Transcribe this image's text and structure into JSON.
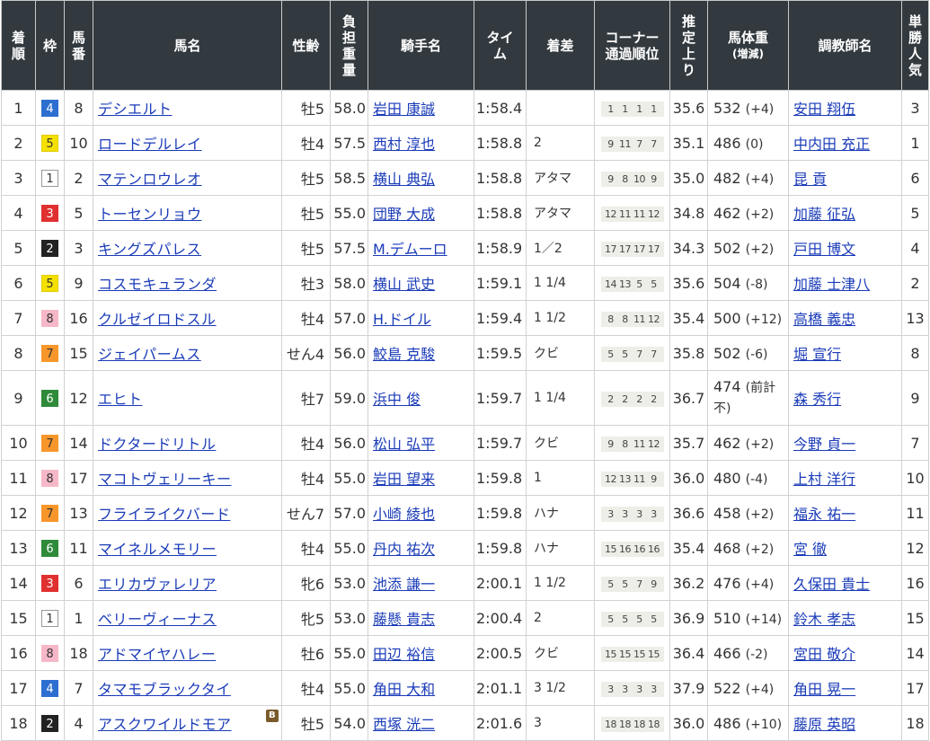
{
  "colors": {
    "header_bg": "#333a3f",
    "link": "#1a3bb8",
    "waku": {
      "1": {
        "bg": "#ffffff",
        "fg": "#333333",
        "border": "#999999"
      },
      "2": {
        "bg": "#222222",
        "fg": "#ffffff",
        "border": "#222222"
      },
      "3": {
        "bg": "#e03030",
        "fg": "#ffffff",
        "border": "#e03030"
      },
      "4": {
        "bg": "#2d6fd0",
        "fg": "#ffffff",
        "border": "#2d6fd0"
      },
      "5": {
        "bg": "#f5e000",
        "fg": "#333333",
        "border": "#e0cc00"
      },
      "6": {
        "bg": "#2f8a3a",
        "fg": "#ffffff",
        "border": "#2f8a3a"
      },
      "7": {
        "bg": "#f7962a",
        "fg": "#333333",
        "border": "#f7962a"
      },
      "8": {
        "bg": "#f6b8c8",
        "fg": "#333333",
        "border": "#f6b8c8"
      }
    }
  },
  "headers": {
    "rank": "着順",
    "waku": "枠",
    "umaban": "馬番",
    "horse": "馬名",
    "sexage": "性齢",
    "weight": "負担重量",
    "jockey": "騎手名",
    "time": "タイム",
    "margin": "着差",
    "corner_line1": "コーナー",
    "corner_line2": "通過順位",
    "last3f": "推定上り",
    "body_line1": "馬体重",
    "body_line2": "(増減)",
    "trainer": "調教師名",
    "pop": "単勝人気"
  },
  "rows": [
    {
      "rank": "1",
      "waku": "4",
      "umaban": "8",
      "horse": "デシエルト",
      "sexage": "牡5",
      "weight": "58.0",
      "jockey": "岩田 康誠",
      "time": "1:58.4",
      "margin": "",
      "corner": [
        "1",
        "1",
        "1",
        "1"
      ],
      "last3f": "35.6",
      "body": "532",
      "diff": "(+4)",
      "trainer": "安田 翔伍",
      "pop": "3"
    },
    {
      "rank": "2",
      "waku": "5",
      "umaban": "10",
      "horse": "ロードデルレイ",
      "sexage": "牡4",
      "weight": "57.5",
      "jockey": "西村 淳也",
      "time": "1:58.8",
      "margin": "2",
      "corner": [
        "9",
        "11",
        "7",
        "7"
      ],
      "last3f": "35.1",
      "body": "486",
      "diff": "(0)",
      "trainer": "中内田 充正",
      "pop": "1"
    },
    {
      "rank": "3",
      "waku": "1",
      "umaban": "2",
      "horse": "マテンロウレオ",
      "sexage": "牡5",
      "weight": "58.5",
      "jockey": "横山 典弘",
      "time": "1:58.8",
      "margin": "アタマ",
      "corner": [
        "9",
        "8",
        "10",
        "9"
      ],
      "last3f": "35.0",
      "body": "482",
      "diff": "(+4)",
      "trainer": "昆 貢",
      "pop": "6"
    },
    {
      "rank": "4",
      "waku": "3",
      "umaban": "5",
      "horse": "トーセンリョウ",
      "sexage": "牡5",
      "weight": "55.0",
      "jockey": "団野 大成",
      "time": "1:58.8",
      "margin": "アタマ",
      "corner": [
        "12",
        "11",
        "11",
        "12"
      ],
      "last3f": "34.8",
      "body": "462",
      "diff": "(+2)",
      "trainer": "加藤 征弘",
      "pop": "5"
    },
    {
      "rank": "5",
      "waku": "2",
      "umaban": "3",
      "horse": "キングズパレス",
      "sexage": "牡5",
      "weight": "57.5",
      "jockey": "M.デムーロ",
      "time": "1:58.9",
      "margin": "1／2",
      "corner": [
        "17",
        "17",
        "17",
        "17"
      ],
      "last3f": "34.3",
      "body": "502",
      "diff": "(+2)",
      "trainer": "戸田 博文",
      "pop": "4"
    },
    {
      "rank": "6",
      "waku": "5",
      "umaban": "9",
      "horse": "コスモキュランダ",
      "sexage": "牡3",
      "weight": "58.0",
      "jockey": "横山 武史",
      "time": "1:59.1",
      "margin": "1 1/4",
      "corner": [
        "14",
        "13",
        "5",
        "5"
      ],
      "last3f": "35.6",
      "body": "504",
      "diff": "(-8)",
      "trainer": "加藤 士津八",
      "pop": "2"
    },
    {
      "rank": "7",
      "waku": "8",
      "umaban": "16",
      "horse": "クルゼイロドスル",
      "sexage": "牡4",
      "weight": "57.0",
      "jockey": "H.ドイル",
      "time": "1:59.4",
      "margin": "1 1/2",
      "corner": [
        "8",
        "8",
        "11",
        "12"
      ],
      "last3f": "35.4",
      "body": "500",
      "diff": "(+12)",
      "trainer": "高橋 義忠",
      "pop": "13"
    },
    {
      "rank": "8",
      "waku": "7",
      "umaban": "15",
      "horse": "ジェイパームス",
      "sexage": "せん4",
      "weight": "56.0",
      "jockey": "鮫島 克駿",
      "time": "1:59.5",
      "margin": "クビ",
      "corner": [
        "5",
        "5",
        "7",
        "7"
      ],
      "last3f": "35.8",
      "body": "502",
      "diff": "(-6)",
      "trainer": "堀 宣行",
      "pop": "8"
    },
    {
      "rank": "9",
      "waku": "6",
      "umaban": "12",
      "horse": "エヒト",
      "sexage": "牡7",
      "weight": "59.0",
      "jockey": "浜中 俊",
      "time": "1:59.7",
      "margin": "1 1/4",
      "corner": [
        "2",
        "2",
        "2",
        "2"
      ],
      "last3f": "36.7",
      "body": "474",
      "diff": "(前計不)",
      "trainer": "森 秀行",
      "pop": "9",
      "tall": true
    },
    {
      "rank": "10",
      "waku": "7",
      "umaban": "14",
      "horse": "ドクタードリトル",
      "sexage": "牡4",
      "weight": "56.0",
      "jockey": "松山 弘平",
      "time": "1:59.7",
      "margin": "クビ",
      "corner": [
        "9",
        "8",
        "11",
        "12"
      ],
      "last3f": "35.7",
      "body": "462",
      "diff": "(+2)",
      "trainer": "今野 貞一",
      "pop": "7"
    },
    {
      "rank": "11",
      "waku": "8",
      "umaban": "17",
      "horse": "マコトヴェリーキー",
      "sexage": "牡4",
      "weight": "55.0",
      "jockey": "岩田 望来",
      "time": "1:59.8",
      "margin": "1",
      "corner": [
        "12",
        "13",
        "11",
        "9"
      ],
      "last3f": "36.0",
      "body": "480",
      "diff": "(-4)",
      "trainer": "上村 洋行",
      "pop": "10"
    },
    {
      "rank": "12",
      "waku": "7",
      "umaban": "13",
      "horse": "フライライクバード",
      "sexage": "せん7",
      "weight": "57.0",
      "jockey": "小崎 綾也",
      "time": "1:59.8",
      "margin": "ハナ",
      "corner": [
        "3",
        "3",
        "3",
        "3"
      ],
      "last3f": "36.6",
      "body": "458",
      "diff": "(+2)",
      "trainer": "福永 祐一",
      "pop": "11"
    },
    {
      "rank": "13",
      "waku": "6",
      "umaban": "11",
      "horse": "マイネルメモリー",
      "sexage": "牡4",
      "weight": "55.0",
      "jockey": "丹内 祐次",
      "time": "1:59.8",
      "margin": "ハナ",
      "corner": [
        "15",
        "16",
        "16",
        "16"
      ],
      "last3f": "35.4",
      "body": "468",
      "diff": "(+2)",
      "trainer": "宮 徹",
      "pop": "12"
    },
    {
      "rank": "14",
      "waku": "3",
      "umaban": "6",
      "horse": "エリカヴァレリア",
      "sexage": "牝6",
      "weight": "53.0",
      "jockey": "池添 謙一",
      "time": "2:00.1",
      "margin": "1 1/2",
      "corner": [
        "5",
        "5",
        "7",
        "9"
      ],
      "last3f": "36.2",
      "body": "476",
      "diff": "(+4)",
      "trainer": "久保田 貴士",
      "pop": "16"
    },
    {
      "rank": "15",
      "waku": "1",
      "umaban": "1",
      "horse": "ベリーヴィーナス",
      "sexage": "牝5",
      "weight": "53.0",
      "jockey": "藤懸 貴志",
      "time": "2:00.4",
      "margin": "2",
      "corner": [
        "5",
        "5",
        "5",
        "5"
      ],
      "last3f": "36.9",
      "body": "510",
      "diff": "(+14)",
      "trainer": "鈴木 孝志",
      "pop": "15"
    },
    {
      "rank": "16",
      "waku": "8",
      "umaban": "18",
      "horse": "アドマイヤハレー",
      "sexage": "牡6",
      "weight": "55.0",
      "jockey": "田辺 裕信",
      "time": "2:00.5",
      "margin": "クビ",
      "corner": [
        "15",
        "15",
        "15",
        "15"
      ],
      "last3f": "36.4",
      "body": "466",
      "diff": "(-2)",
      "trainer": "宮田 敬介",
      "pop": "14"
    },
    {
      "rank": "17",
      "waku": "4",
      "umaban": "7",
      "horse": "タマモブラックタイ",
      "sexage": "牡4",
      "weight": "55.0",
      "jockey": "角田 大和",
      "time": "2:01.1",
      "margin": "3 1/2",
      "corner": [
        "3",
        "3",
        "3",
        "3"
      ],
      "last3f": "37.9",
      "body": "522",
      "diff": "(+4)",
      "trainer": "角田 晃一",
      "pop": "17"
    },
    {
      "rank": "18",
      "waku": "2",
      "umaban": "4",
      "horse": "アスクワイルドモア",
      "sexage": "牡5",
      "weight": "54.0",
      "jockey": "西塚 洸二",
      "time": "2:01.6",
      "margin": "3",
      "corner": [
        "18",
        "18",
        "18",
        "18"
      ],
      "last3f": "36.0",
      "body": "486",
      "diff": "(+10)",
      "trainer": "藤原 英昭",
      "pop": "18",
      "blinker": "B"
    }
  ]
}
